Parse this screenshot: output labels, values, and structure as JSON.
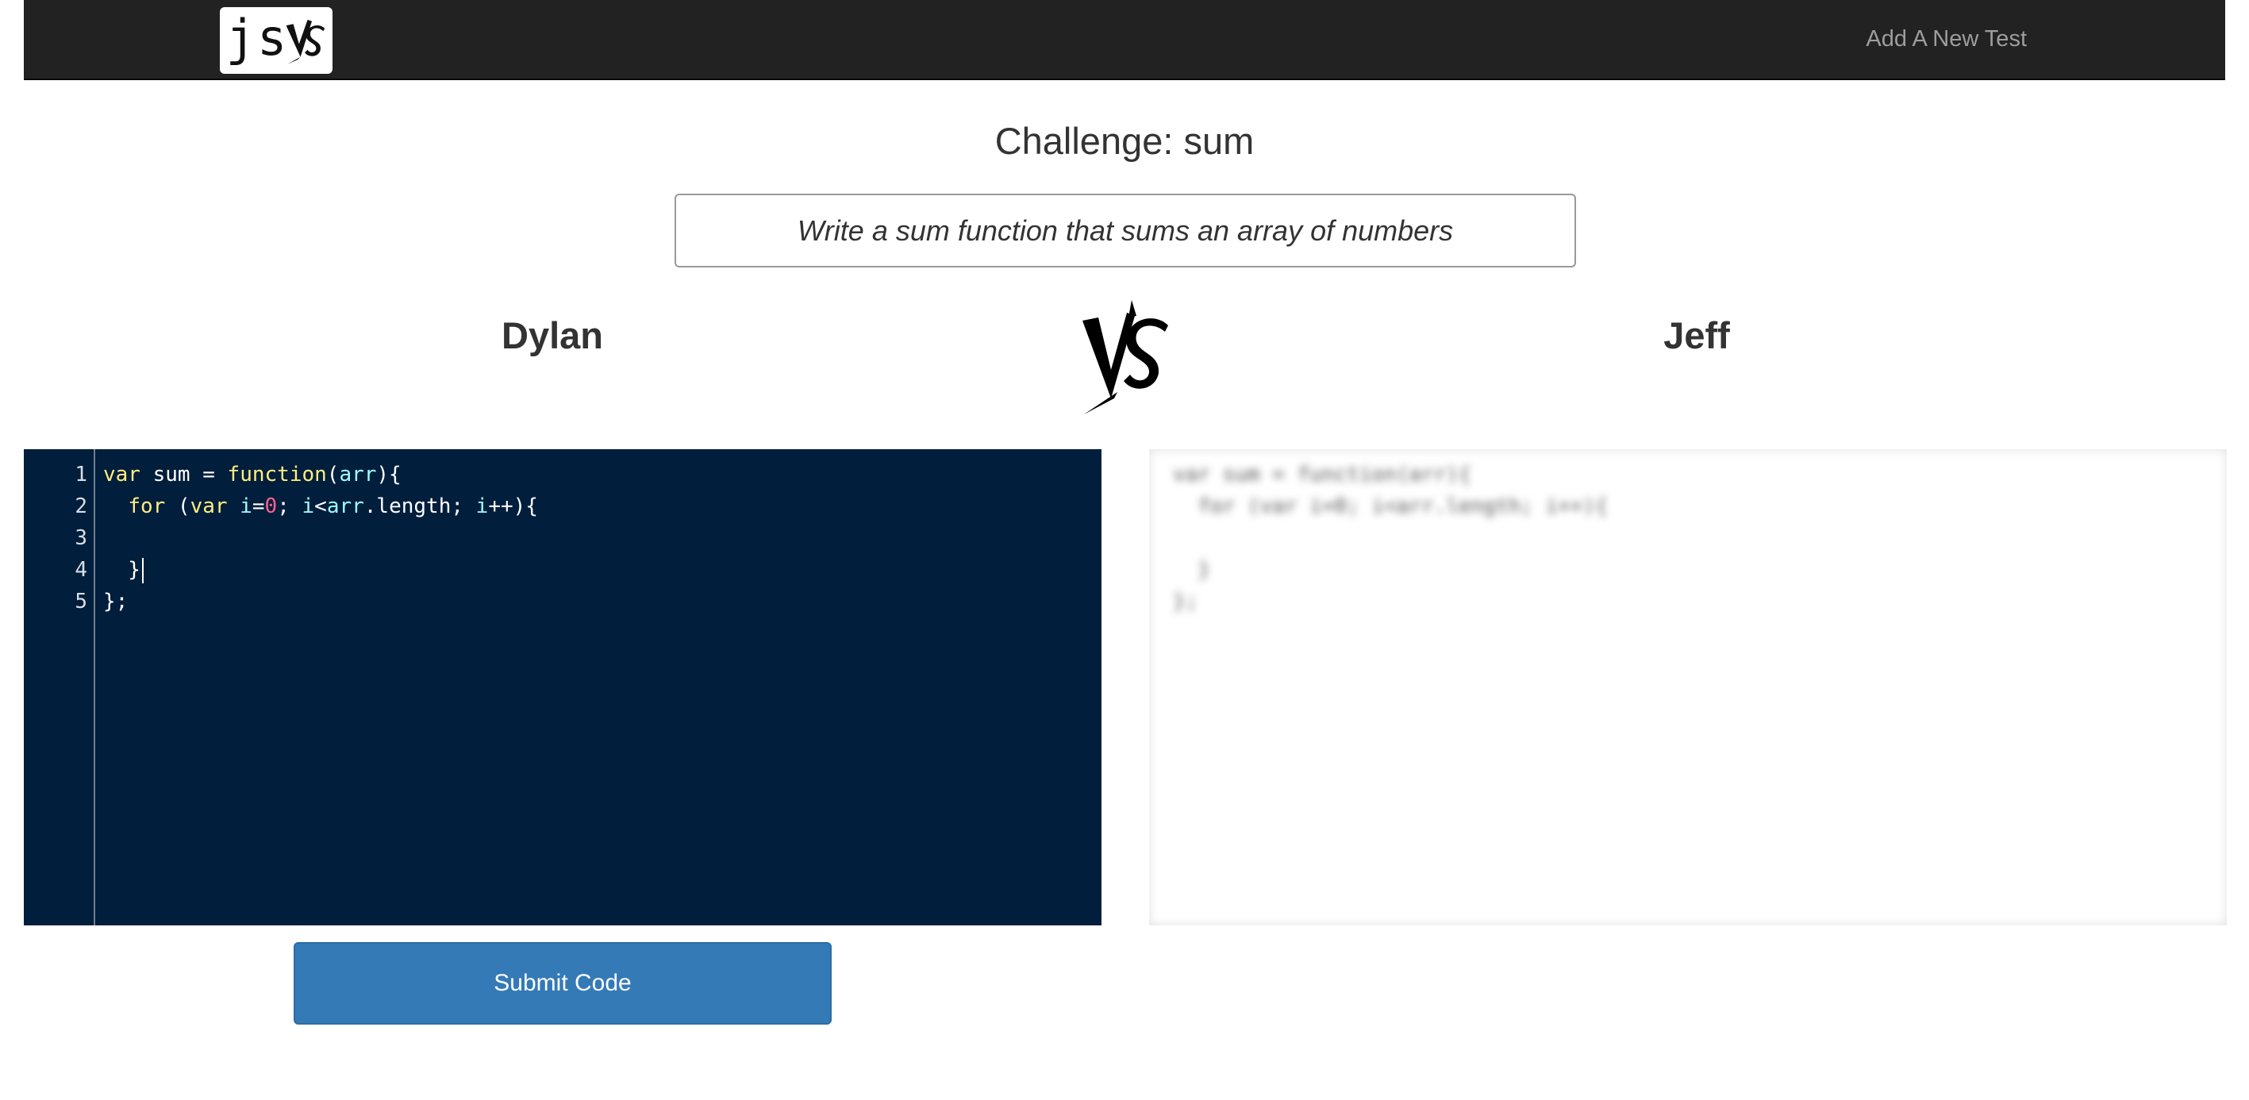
{
  "navbar": {
    "brand_text": "js",
    "brand_vs_icon": "vs-logo-icon",
    "add_test_link": "Add A New Test"
  },
  "challenge": {
    "title": "Challenge: sum",
    "prompt": "Write a sum function that sums an array of numbers"
  },
  "players": {
    "left": "Dylan",
    "right": "Jeff",
    "vs_icon": "vs-logo-icon"
  },
  "editor_left": {
    "line_numbers": [
      "1",
      "2",
      "3",
      "4",
      "5"
    ],
    "lines": [
      "var sum = function(arr){",
      "  for (var i=0; i<arr.length; i++){",
      "",
      "  }",
      "};"
    ],
    "theme_bg": "#011e3c"
  },
  "editor_right": {
    "blurred": true,
    "lines": [
      "var sum = function(arr){",
      "  for (var i=0; i<arr.length; i++){",
      "",
      "  }",
      "};"
    ]
  },
  "submit": {
    "label": "Submit Code",
    "color": "#337ab7"
  }
}
